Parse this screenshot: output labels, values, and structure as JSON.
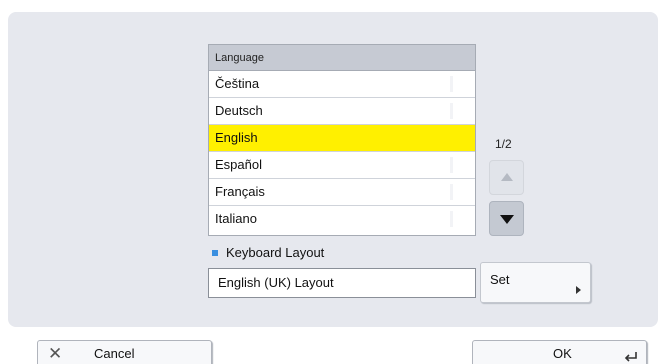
{
  "language_list": {
    "header": "Language",
    "items": [
      {
        "label": "Čeština",
        "selected": false
      },
      {
        "label": "Deutsch",
        "selected": false
      },
      {
        "label": "English",
        "selected": true
      },
      {
        "label": "Español",
        "selected": false
      },
      {
        "label": "Français",
        "selected": false
      },
      {
        "label": "Italiano",
        "selected": false
      }
    ],
    "page_indicator": "1/2"
  },
  "keyboard": {
    "label": "Keyboard Layout",
    "value": "English (UK) Layout",
    "set_label": "Set"
  },
  "footer": {
    "cancel_label": "Cancel",
    "ok_label": "OK"
  },
  "icons": {
    "scroll_up": "triangle-up-icon",
    "scroll_down": "triangle-down-icon",
    "cancel": "x-icon",
    "ok": "enter-icon",
    "set": "arrow-right-icon",
    "bullet": "square-bullet-icon"
  },
  "colors": {
    "selected_row": "#fff000",
    "panel_bg": "#e6e8ee",
    "bullet": "#3a8fe0"
  }
}
